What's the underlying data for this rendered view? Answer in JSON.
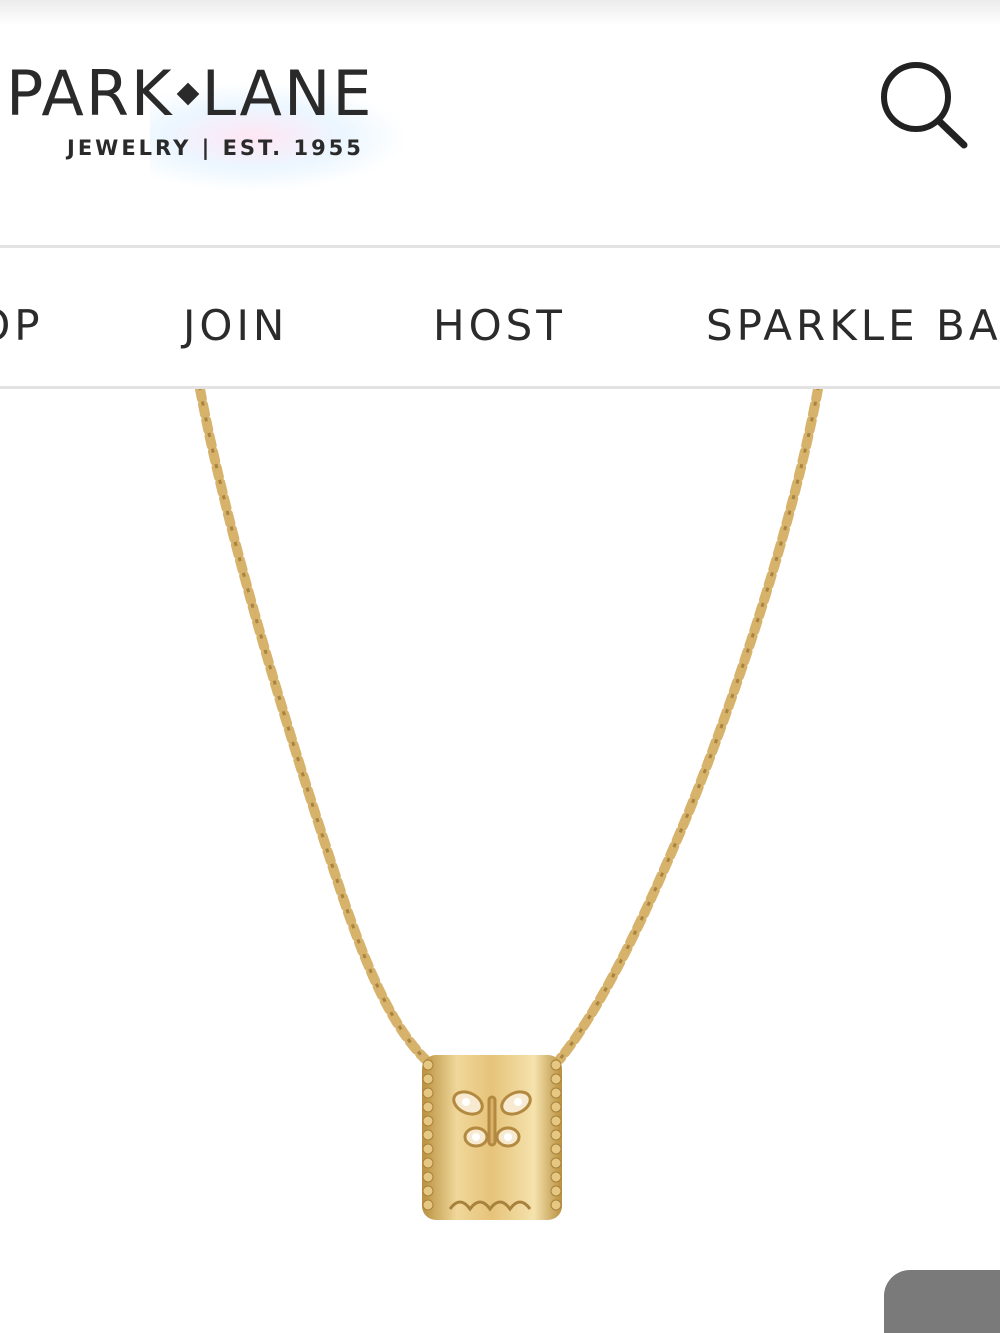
{
  "header": {
    "logo": {
      "brand_left": "PARK",
      "brand_right": "LANE",
      "tagline": "JEWELRY | EST. 1955"
    },
    "search_icon": "search-icon"
  },
  "nav": {
    "items": [
      {
        "label": "SHOP"
      },
      {
        "label": "JOIN"
      },
      {
        "label": "HOST"
      },
      {
        "label": "SPARKLE BAR"
      }
    ]
  },
  "product": {
    "image_subject": "gold chain necklace with butterfly barrel pendant"
  },
  "colors": {
    "text": "#2a2a2a",
    "divider": "#e3e3e3",
    "gold": "#d4b06a",
    "floating_button": "#7a7a7a"
  }
}
